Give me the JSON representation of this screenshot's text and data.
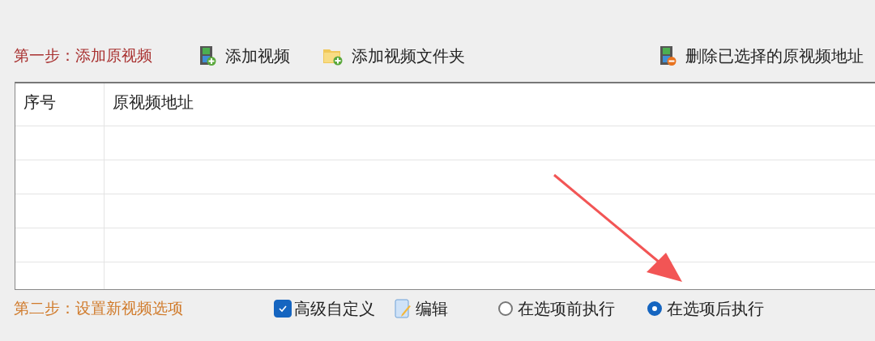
{
  "step1": {
    "label": "第一步：添加原视频",
    "buttons": [
      {
        "kind": "add-video",
        "label": "添加视频"
      },
      {
        "kind": "add-folder",
        "label": "添加视频文件夹"
      },
      {
        "kind": "delete",
        "label": "删除已选择的原视频地址"
      }
    ]
  },
  "table": {
    "columns": [
      "序号",
      "原视频地址"
    ]
  },
  "step2": {
    "label": "第二步：设置新视频选项",
    "checkbox": {
      "label": "高级自定义",
      "checked": true
    },
    "edit_button": {
      "label": "编辑"
    },
    "radios": [
      {
        "label": "在选项前执行",
        "selected": false
      },
      {
        "label": "在选项后执行",
        "selected": true
      }
    ]
  }
}
